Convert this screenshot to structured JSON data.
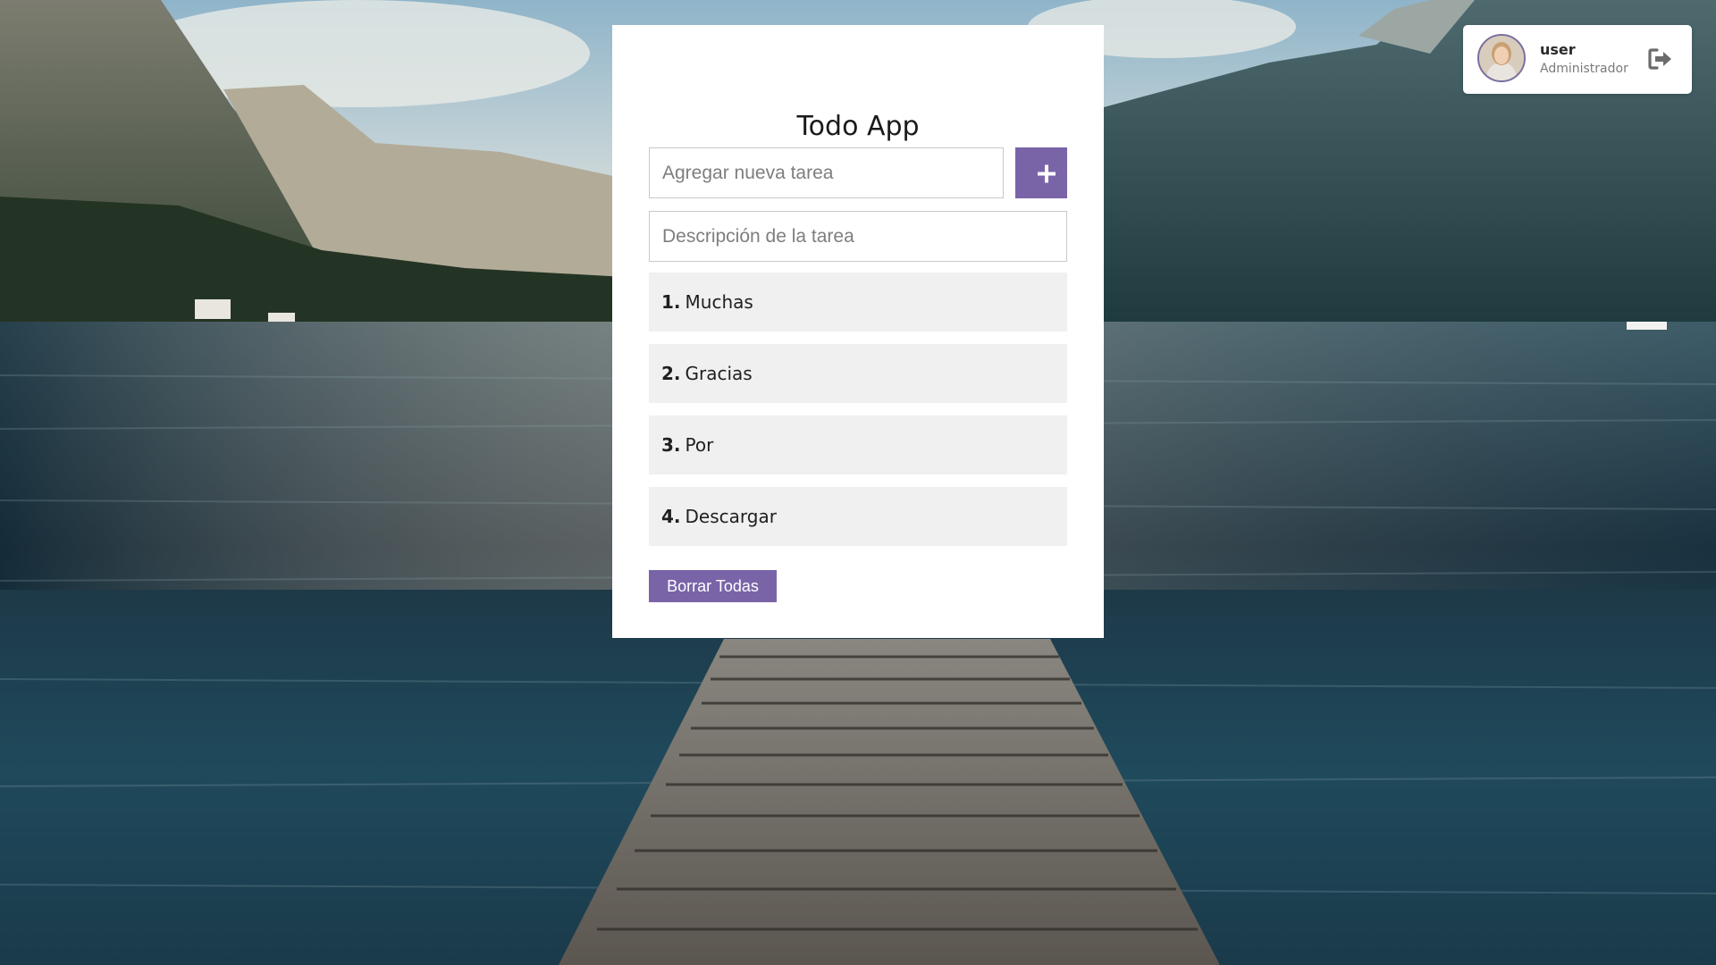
{
  "app": {
    "title": "Todo App"
  },
  "form": {
    "task_placeholder": "Agregar nueva tarea",
    "description_placeholder": "Descripción de la tarea",
    "add_icon": "plus-icon"
  },
  "tasks": [
    {
      "number": "1.",
      "label": "Muchas"
    },
    {
      "number": "2.",
      "label": "Gracias"
    },
    {
      "number": "3.",
      "label": "Por"
    },
    {
      "number": "4.",
      "label": "Descargar"
    }
  ],
  "actions": {
    "clear_all_label": "Borrar Todas"
  },
  "user": {
    "name": "user",
    "role": "Administrador",
    "logout_icon": "logout-icon"
  },
  "colors": {
    "accent": "#7a64a8",
    "card_background": "#ffffff",
    "task_background": "#f0f0f0"
  }
}
